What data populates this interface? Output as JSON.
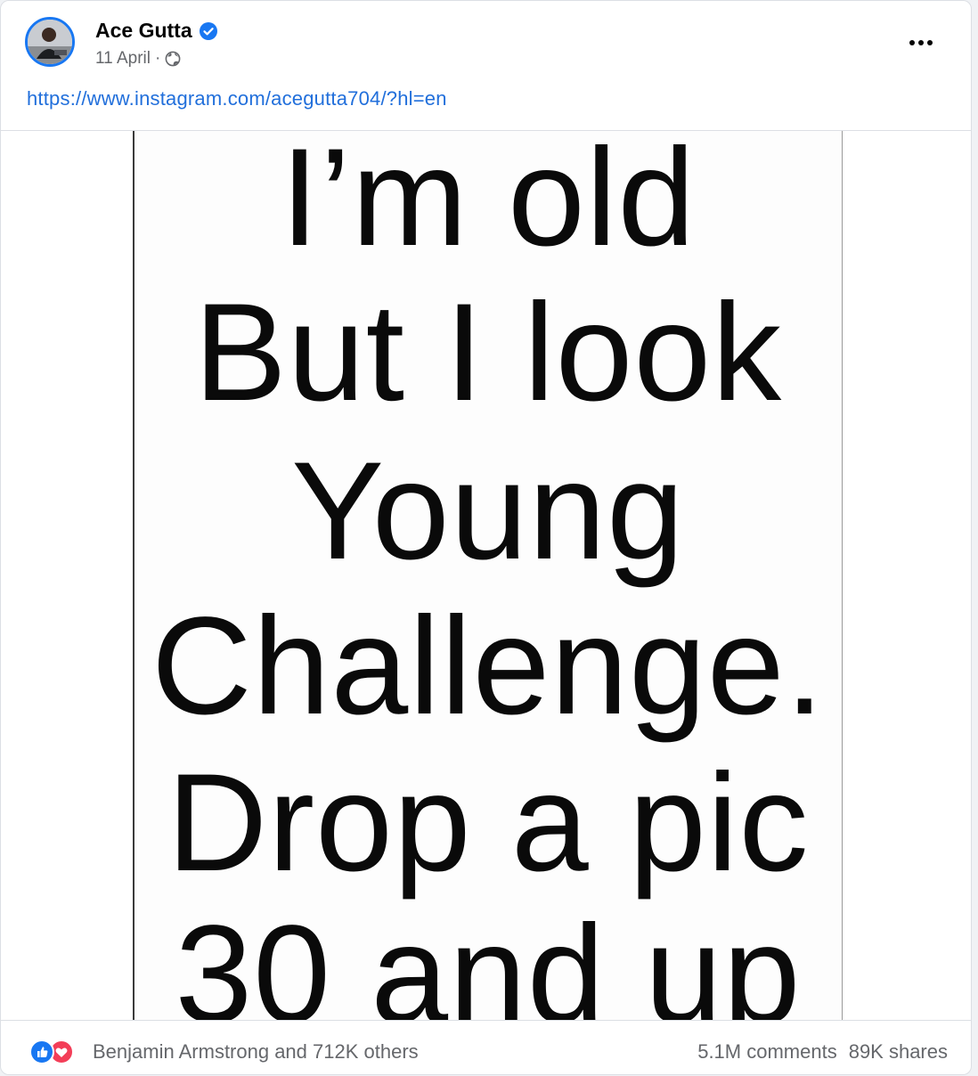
{
  "post": {
    "author": "Ace Gutta",
    "verified": true,
    "date": "11 April",
    "separator": "·",
    "audience_icon": "globe-icon",
    "more_icon": "more-options-icon",
    "link_text": "https://www.instagram.com/acegutta704/?hl=en"
  },
  "image_text": {
    "lines": [
      "I’m old",
      "But I look",
      "Young",
      "Challenge.",
      "Drop a pic",
      "30 and up"
    ]
  },
  "footer": {
    "reaction_icons": [
      "like-icon",
      "love-icon"
    ],
    "reactors": "Benjamin Armstrong and 712K others",
    "comments": "5.1M comments",
    "shares": "89K shares"
  },
  "colors": {
    "link": "#216fdb",
    "verified": "#1877f2",
    "like": "#1877f2",
    "love": "#f33e58",
    "muted_text": "#65676b"
  }
}
